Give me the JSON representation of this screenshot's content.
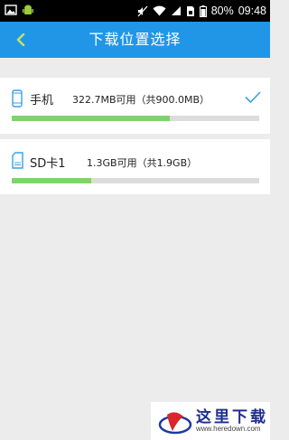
{
  "status_bar": {
    "battery": "80%",
    "time": "09:48"
  },
  "app_bar": {
    "title": "下载位置选择"
  },
  "storage": [
    {
      "name": "手机",
      "info": "322.7MB可用（共900.0MB）",
      "used_fraction": 0.64,
      "selected": true,
      "icon": "phone-icon"
    },
    {
      "name": "SD卡1",
      "info": "1.3GB可用（共1.9GB）",
      "used_fraction": 0.32,
      "selected": false,
      "icon": "sd-card-icon"
    }
  ],
  "colors": {
    "accent": "#2196e6",
    "bar_fill": "#7fd36c",
    "bar_track": "#dcdcdc"
  },
  "watermark": {
    "text": "这里下载",
    "url": "www.heredown.com"
  }
}
